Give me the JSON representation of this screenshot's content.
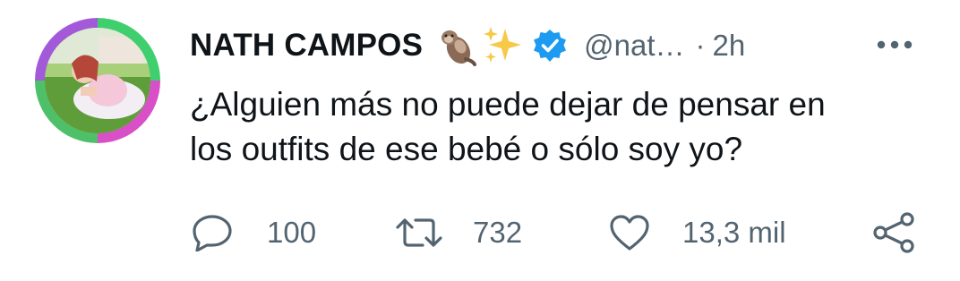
{
  "tweet": {
    "display_name": "NATH CAMPOS",
    "emojis": [
      "otter-emoji",
      "sparkles-emoji"
    ],
    "verified": true,
    "handle": "@nat…",
    "separator": "·",
    "time": "2h",
    "text_line1": "¿Alguien más no puede dejar de pensar en",
    "text_line2": "los outfits de ese bebé o sólo soy yo?"
  },
  "actions": {
    "reply_count": "100",
    "retweet_count": "732",
    "like_count": "13,3 mil"
  },
  "colors": {
    "text_primary": "#0f1419",
    "text_secondary": "#536471",
    "verified_blue": "#1d9bf0"
  }
}
